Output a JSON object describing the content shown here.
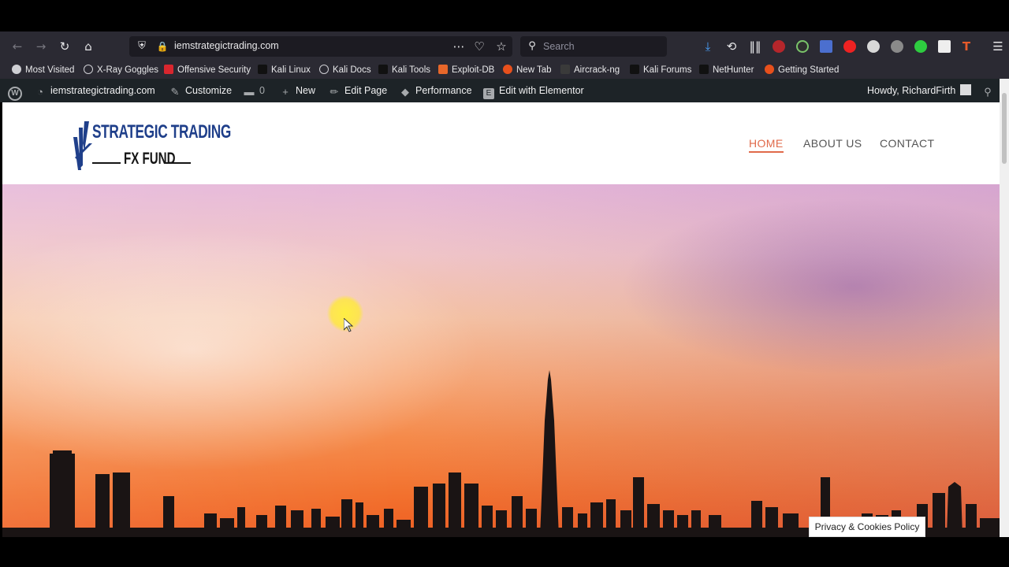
{
  "browser": {
    "url": "iemstrategictrading.com",
    "search_placeholder": "Search",
    "icons": [
      "back-icon",
      "forward-icon",
      "reload-icon",
      "home-icon",
      "shield-icon",
      "page-actions-icon",
      "pocket-icon",
      "star-icon",
      "download-icon",
      "history-icon",
      "library-icon",
      "menu-icon"
    ],
    "bookmarks": [
      {
        "label": "Most Visited",
        "icon": "gear-icon",
        "color": "#cfcfd4"
      },
      {
        "label": "X-Ray Goggles",
        "icon": "globe-icon",
        "color": "#cfcfd4"
      },
      {
        "label": "Offensive Security",
        "icon": "offsec-icon",
        "color": "#d9262e"
      },
      {
        "label": "Kali Linux",
        "icon": "kali-icon",
        "color": "#1f1f1f"
      },
      {
        "label": "Kali Docs",
        "icon": "globe-icon",
        "color": "#cfcfd4"
      },
      {
        "label": "Kali Tools",
        "icon": "kali-icon",
        "color": "#1f1f1f"
      },
      {
        "label": "Exploit-DB",
        "icon": "exploitdb-icon",
        "color": "#e8672a"
      },
      {
        "label": "New Tab",
        "icon": "firefox-icon",
        "color": "#e8501c"
      },
      {
        "label": "Aircrack-ng",
        "icon": "aircrack-icon",
        "color": "#3a3a3a"
      },
      {
        "label": "Kali Forums",
        "icon": "kali-icon",
        "color": "#1f1f1f"
      },
      {
        "label": "NetHunter",
        "icon": "kali-icon",
        "color": "#1f1f1f"
      },
      {
        "label": "Getting Started",
        "icon": "firefox-icon",
        "color": "#e8501c"
      }
    ]
  },
  "wp_admin": {
    "site": "iemstrategictrading.com",
    "customize": "Customize",
    "comments": "0",
    "new": "New",
    "edit_page": "Edit Page",
    "performance": "Performance",
    "elementor": "Edit with Elementor",
    "howdy": "Howdy, RichardFirth"
  },
  "site": {
    "logo_line1": "STRATEGIC TRADING",
    "logo_line2": "FX FUND",
    "nav": [
      "HOME",
      "ABOUT US",
      "CONTACT"
    ],
    "active_nav": "HOME",
    "accent": "#e06a4a",
    "brand_blue": "#1f3f8a"
  },
  "cookie_notice": "Privacy & Cookies Policy"
}
